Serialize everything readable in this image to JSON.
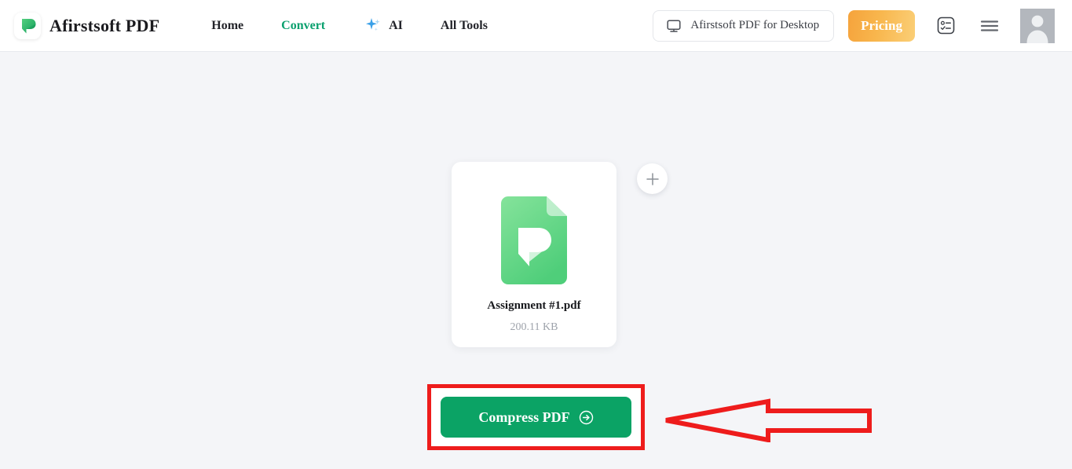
{
  "header": {
    "brand": {
      "logo_icon": "afirstsoft-p-logo-icon",
      "name": "Afirstsoft PDF"
    },
    "nav": [
      {
        "label": "Home",
        "active": false,
        "icon": null
      },
      {
        "label": "Convert",
        "active": true,
        "icon": null
      },
      {
        "label": "AI",
        "active": false,
        "icon": "sparkle-icon"
      },
      {
        "label": "All Tools",
        "active": false,
        "icon": null
      }
    ],
    "desktop_button": {
      "label": "Afirstsoft PDF for Desktop",
      "icon": "monitor-icon"
    },
    "pricing_button": {
      "label": "Pricing"
    },
    "tasks_icon": "checklist-icon",
    "menu_icon": "hamburger-menu-icon",
    "avatar_icon": "user-avatar-icon",
    "colors": {
      "active_nav": "#0aa06e",
      "pricing_gradient_start": "#f5a33c",
      "pricing_gradient_end": "#fbcf77"
    }
  },
  "main": {
    "file_card": {
      "icon": "pdf-file-icon",
      "name": "Assignment #1.pdf",
      "size": "200.11 KB"
    },
    "add_file_button": {
      "icon": "plus-icon"
    },
    "action_button": {
      "label": "Compress PDF",
      "icon": "arrow-circle-right-icon"
    }
  },
  "annotations": {
    "highlight_box": {
      "shape": "rectangle",
      "color": "#ee1c1c"
    },
    "pointer_arrow": {
      "shape": "arrow-left",
      "color": "#ee1c1c"
    }
  },
  "colors": {
    "page_background": "#f4f5f8",
    "header_background": "#ffffff",
    "primary_green": "#0ba365",
    "annotation_red": "#ee1c1c"
  }
}
